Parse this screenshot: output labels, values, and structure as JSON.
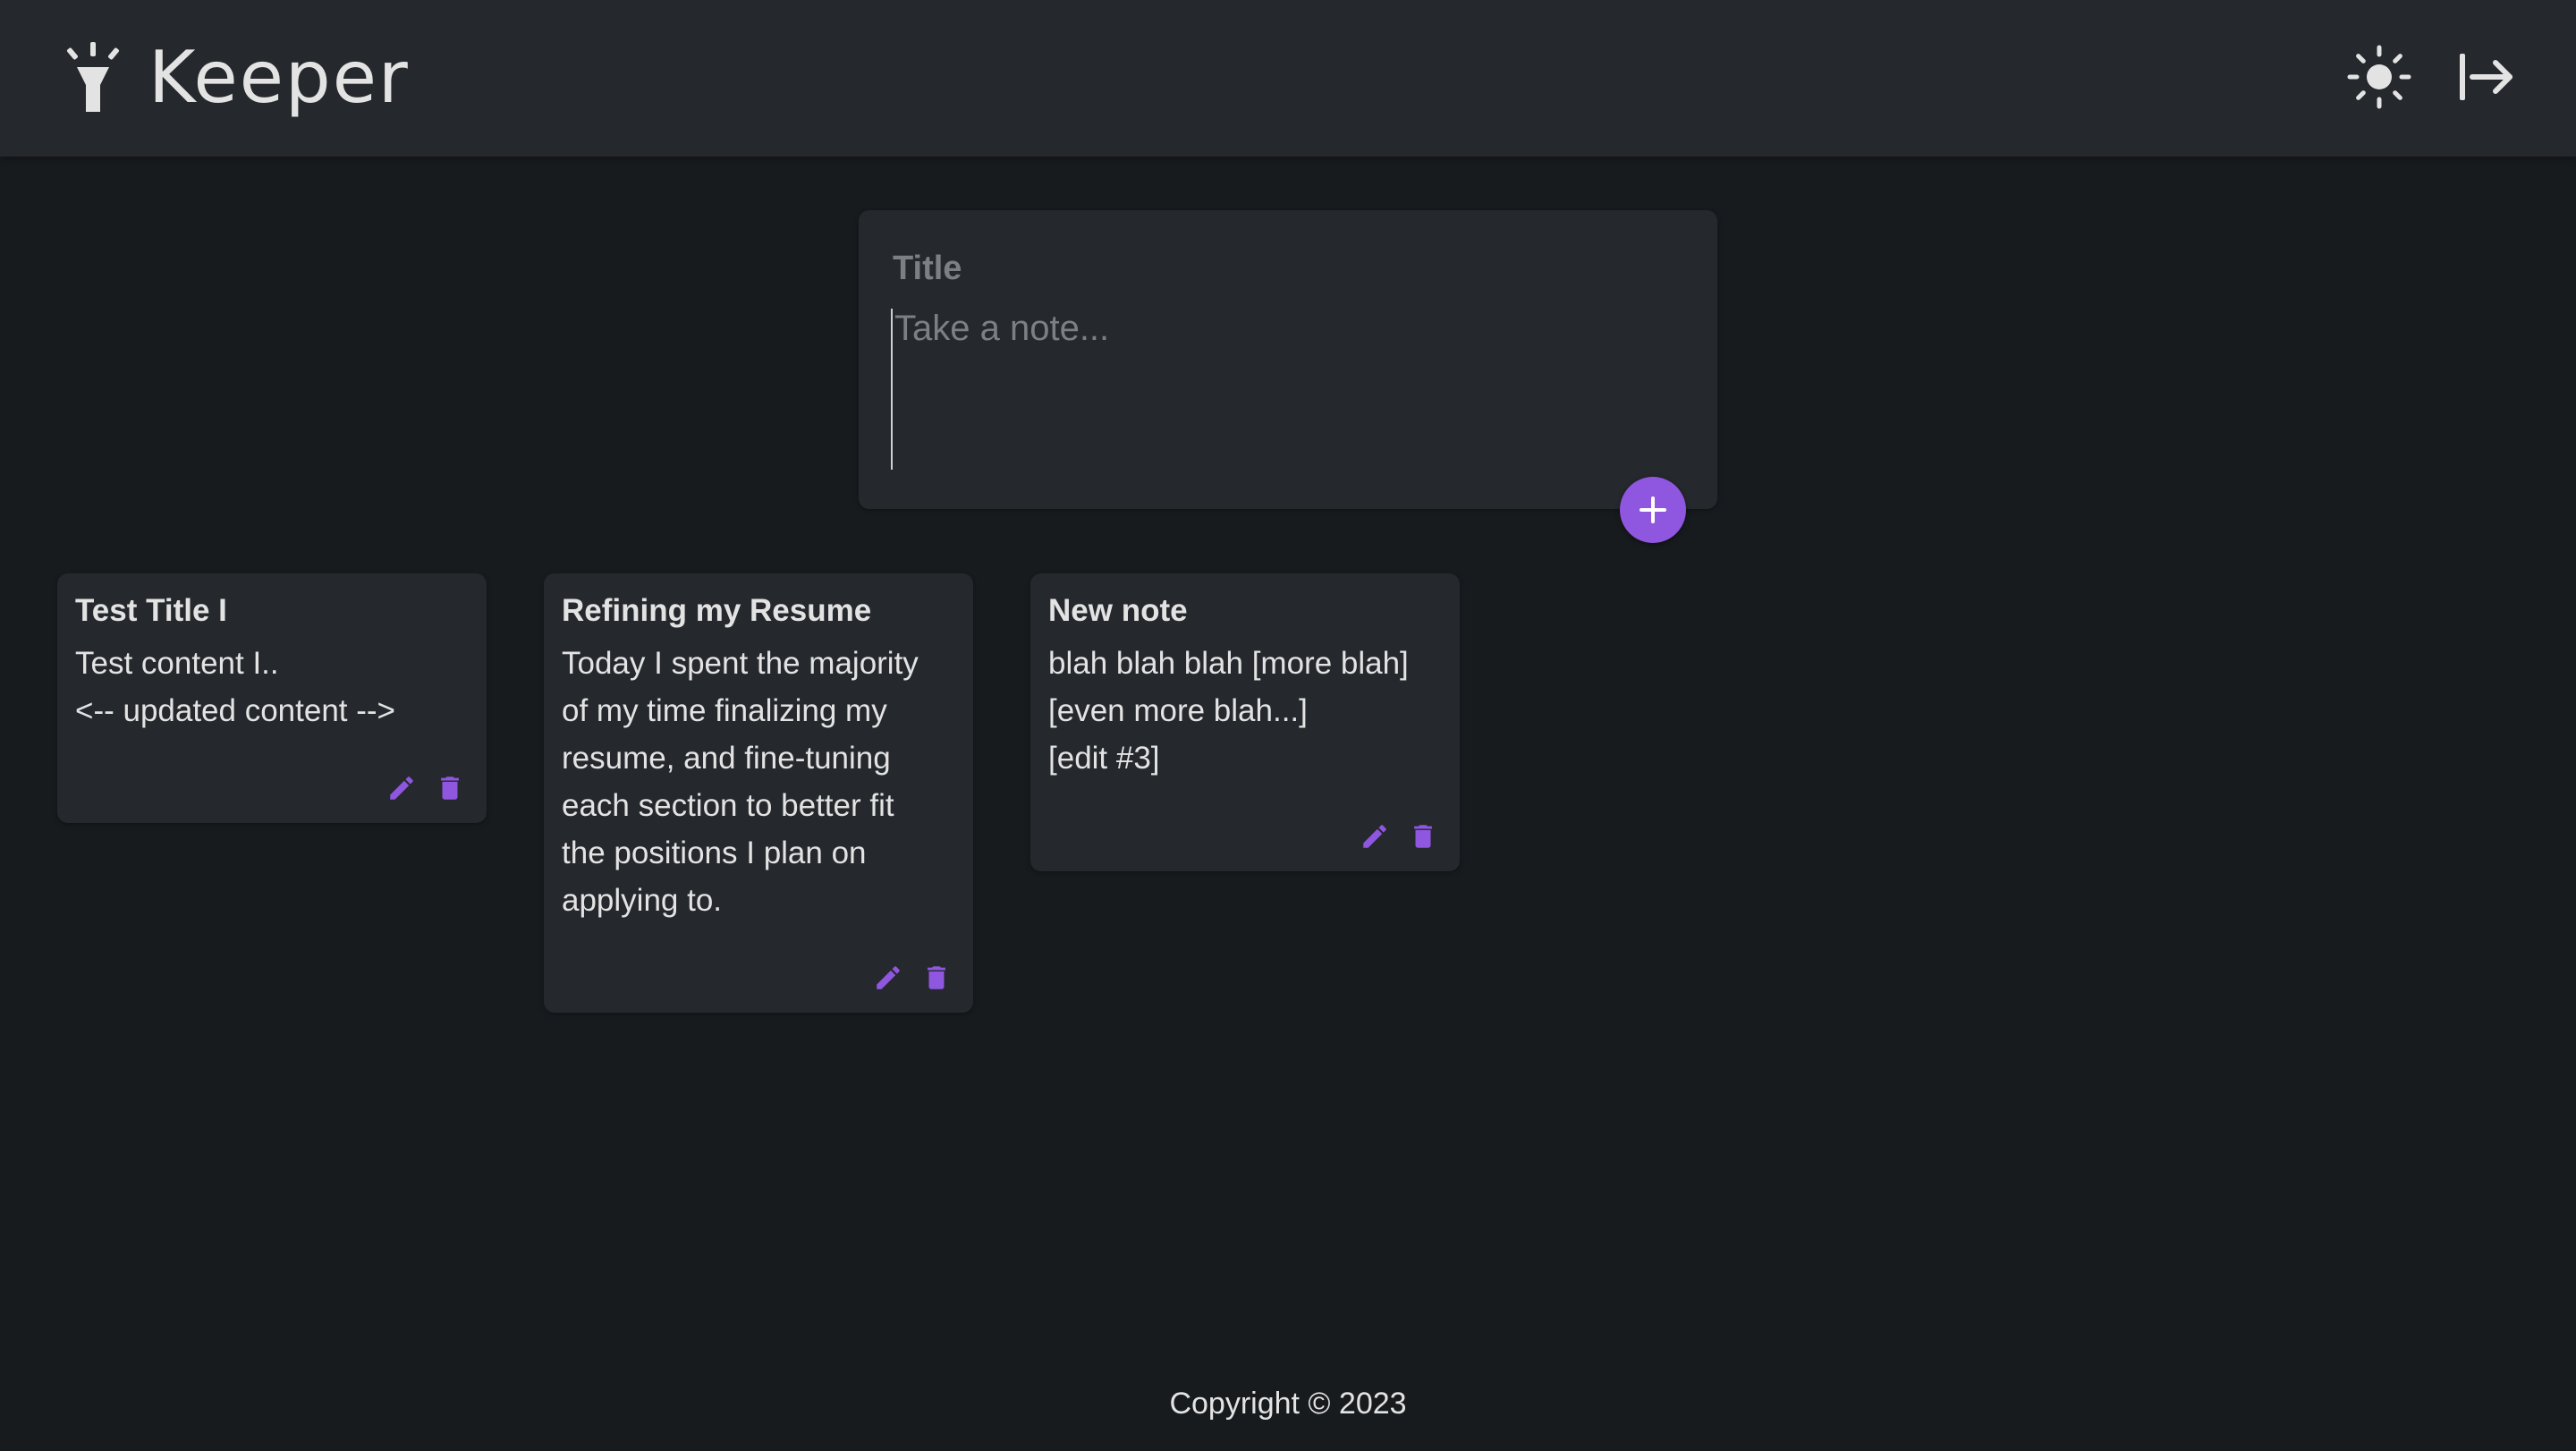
{
  "header": {
    "app_title": "Keeper",
    "logo_icon": "flashlight-icon",
    "theme_toggle_icon": "sun-icon",
    "logout_icon": "logout-arrow-icon"
  },
  "compose": {
    "title_placeholder": "Title",
    "content_placeholder": "Take a note...",
    "add_icon": "plus-icon"
  },
  "notes": [
    {
      "title": "Test Title I",
      "lines": [
        "Test content I..",
        "<-- updated content -->"
      ]
    },
    {
      "title": "Refining my Resume",
      "lines": [
        "Today I spent the majority",
        "of my time finalizing my",
        "resume, and fine-tuning",
        "each section to better fit",
        "the positions I plan on",
        "applying to."
      ]
    },
    {
      "title": "New note",
      "lines": [
        "blah blah blah [more blah]",
        "[even more blah...]",
        "[edit #3]"
      ]
    }
  ],
  "footer": {
    "copyright": "Copyright © 2023"
  },
  "colors": {
    "accent": "#8f56e0",
    "header_bg": "#25282c",
    "page_bg": "#181b1e",
    "card_bg": "#25282c"
  }
}
